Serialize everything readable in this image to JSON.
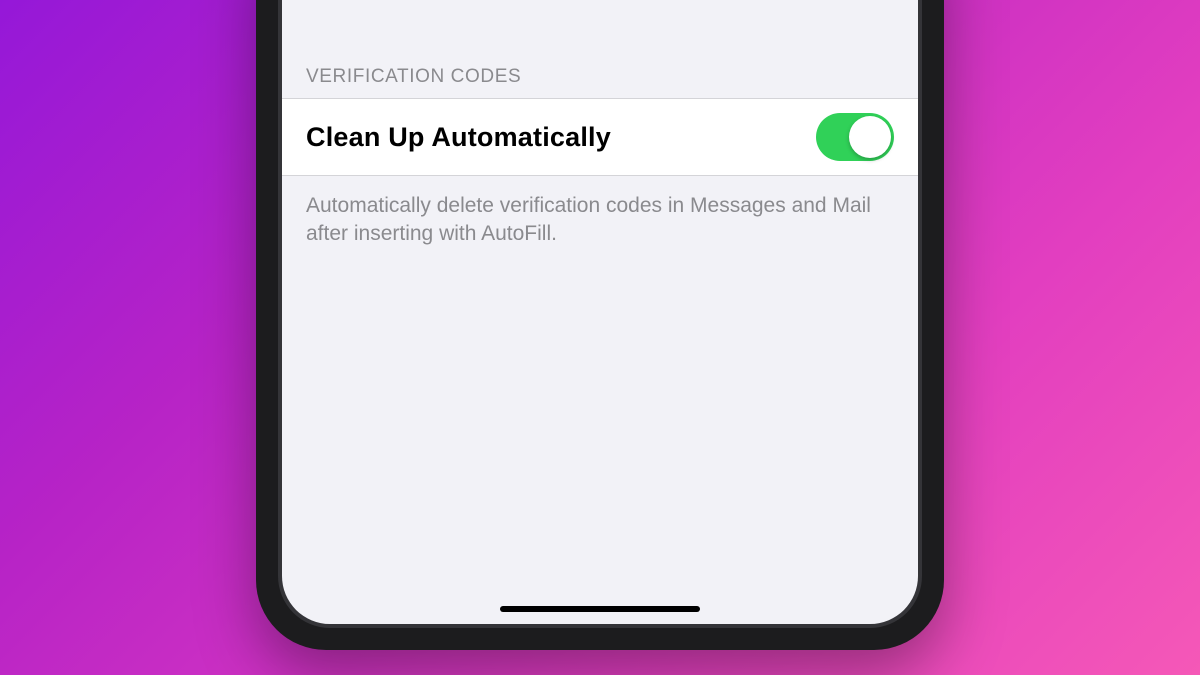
{
  "section": {
    "header": "VERIFICATION CODES",
    "row": {
      "label": "Clean Up Automatically",
      "toggle_on": true
    },
    "footer": "Automatically delete verification codes in Messages and Mail after inserting with AutoFill."
  },
  "colors": {
    "toggle_on": "#30d158",
    "background": "#f2f2f7",
    "row_bg": "#ffffff",
    "text_secondary": "#8a8a8e"
  }
}
